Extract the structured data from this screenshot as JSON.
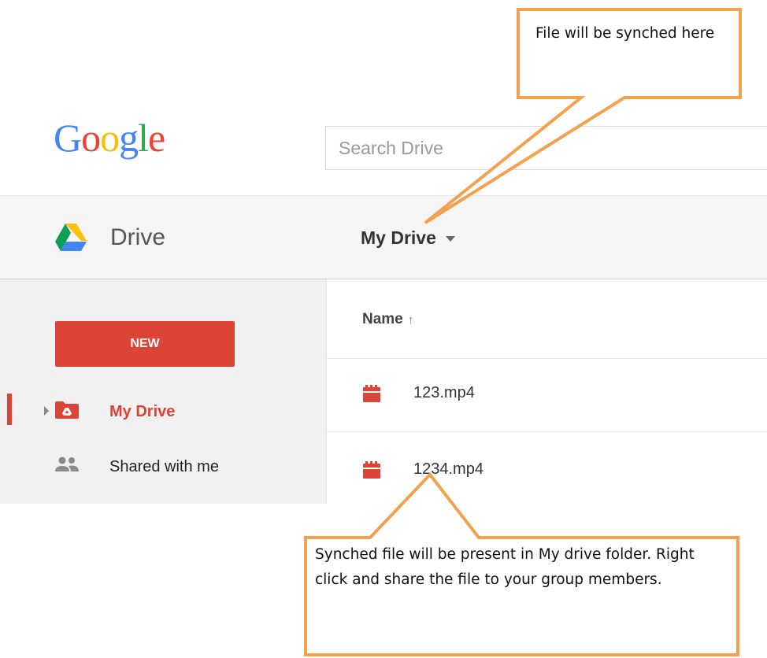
{
  "logo": {
    "letters": [
      "G",
      "o",
      "o",
      "g",
      "l",
      "e"
    ],
    "letter_colors": [
      "#4285f4",
      "#ea4335",
      "#fbbc05",
      "#4285f4",
      "#34a853",
      "#ea4335"
    ]
  },
  "search": {
    "placeholder": "Search Drive",
    "value": ""
  },
  "header": {
    "app_name": "Drive",
    "current_folder": "My Drive",
    "app_icon": "google-drive-icon"
  },
  "sidebar": {
    "new_button_label": "NEW",
    "items": [
      {
        "label": "My Drive",
        "icon": "drive-folder-icon",
        "active": true
      },
      {
        "label": "Shared with me",
        "icon": "people-icon",
        "active": false
      }
    ]
  },
  "file_list": {
    "column_header": "Name",
    "sort_indicator": "↑",
    "files": [
      {
        "name": "123.mp4",
        "icon": "video-file-icon"
      },
      {
        "name": "1234.mp4",
        "icon": "video-file-icon"
      }
    ]
  },
  "annotations": {
    "top_callout": "File will be synched here",
    "bottom_callout": "Synched file will be present in My drive folder. Right click and share the file to your group members."
  },
  "colors": {
    "accent_red": "#db4437",
    "callout_border": "#f2a24f",
    "header_bg": "#f5f5f5",
    "sidebar_bg": "#f1f1f1"
  }
}
